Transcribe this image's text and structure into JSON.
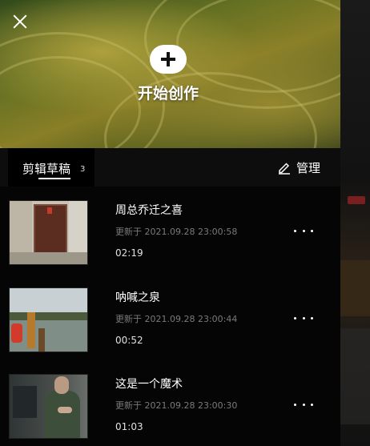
{
  "header": {
    "create_label": "开始创作"
  },
  "tabs": {
    "drafts_label": "剪辑草稿",
    "drafts_count": "3",
    "manage_label": "管理"
  },
  "drafts": [
    {
      "title": "周总乔迁之喜",
      "updated": "更新于 2021.09.28 23:00:58",
      "duration": "02:19",
      "thumb_icon": "door-photo"
    },
    {
      "title": "呐喊之泉",
      "updated": "更新于 2021.09.28 23:00:44",
      "duration": "00:52",
      "thumb_icon": "lake-photo"
    },
    {
      "title": "这是一个魔术",
      "updated": "更新于 2021.09.28 23:00:30",
      "duration": "01:03",
      "thumb_icon": "man-photo"
    }
  ],
  "colors": {
    "background": "#050505",
    "text_primary": "#ffffff",
    "text_secondary": "#7a7a7a"
  }
}
